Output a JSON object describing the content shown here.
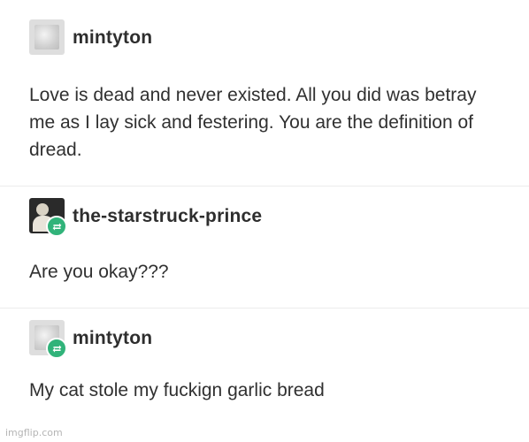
{
  "posts": [
    {
      "username": "mintyton",
      "avatar": "light-gray-avatar",
      "reblog": false,
      "text": "Love is dead and never existed. All you did was betray me as I lay sick and festering. You are the definition of dread."
    },
    {
      "username": "the-starstruck-prince",
      "avatar": "dark-photo-avatar",
      "reblog": true,
      "text": "Are you okay???"
    },
    {
      "username": "mintyton",
      "avatar": "light-gray-avatar",
      "reblog": true,
      "text": "My cat stole my fuckign garlic bread"
    }
  ],
  "icons": {
    "reblog": "reblog-icon"
  },
  "colors": {
    "reblog_badge": "#31b37a",
    "divider": "#ececec"
  },
  "watermark": "imgflip.com"
}
